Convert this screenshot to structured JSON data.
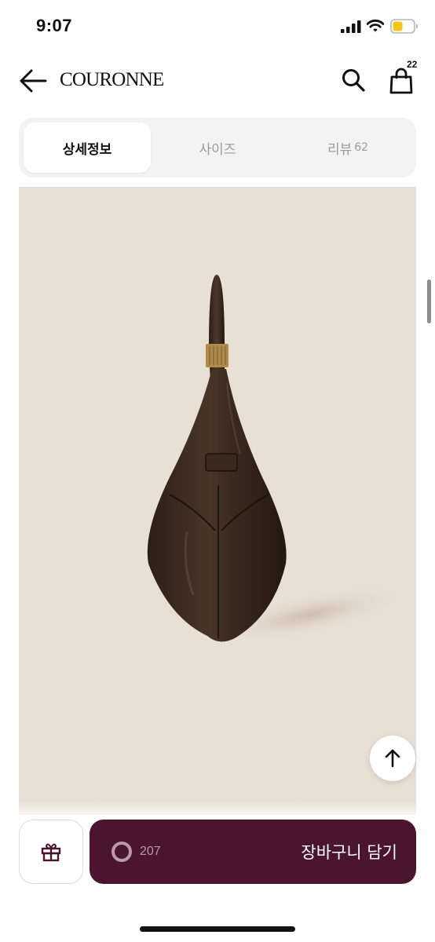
{
  "status_bar": {
    "time": "9:07",
    "icons": [
      "signal-icon",
      "wifi-icon",
      "battery-icon"
    ],
    "battery_color": "#f5c518"
  },
  "header": {
    "back_icon": "arrow-left-icon",
    "brand": "COURONNE",
    "search_icon": "search-icon",
    "cart_icon": "shopping-bag-icon",
    "cart_count": "22"
  },
  "tabs": [
    {
      "label": "상세정보",
      "active": true
    },
    {
      "label": "사이즈",
      "active": false
    },
    {
      "label": "리뷰",
      "count": "62",
      "active": false
    }
  ],
  "product_image": {
    "background_color": "#e8dfd5",
    "bag_color": "#3a2a20",
    "hardware_color": "#b08a4a"
  },
  "scroll_top_icon": "arrow-up-icon",
  "bottom_bar": {
    "gift_icon": "gift-icon",
    "like_count": "207",
    "cart_button_label": "장바구니 담기",
    "button_color": "#4b1530",
    "accent_color": "#b89aa8"
  }
}
